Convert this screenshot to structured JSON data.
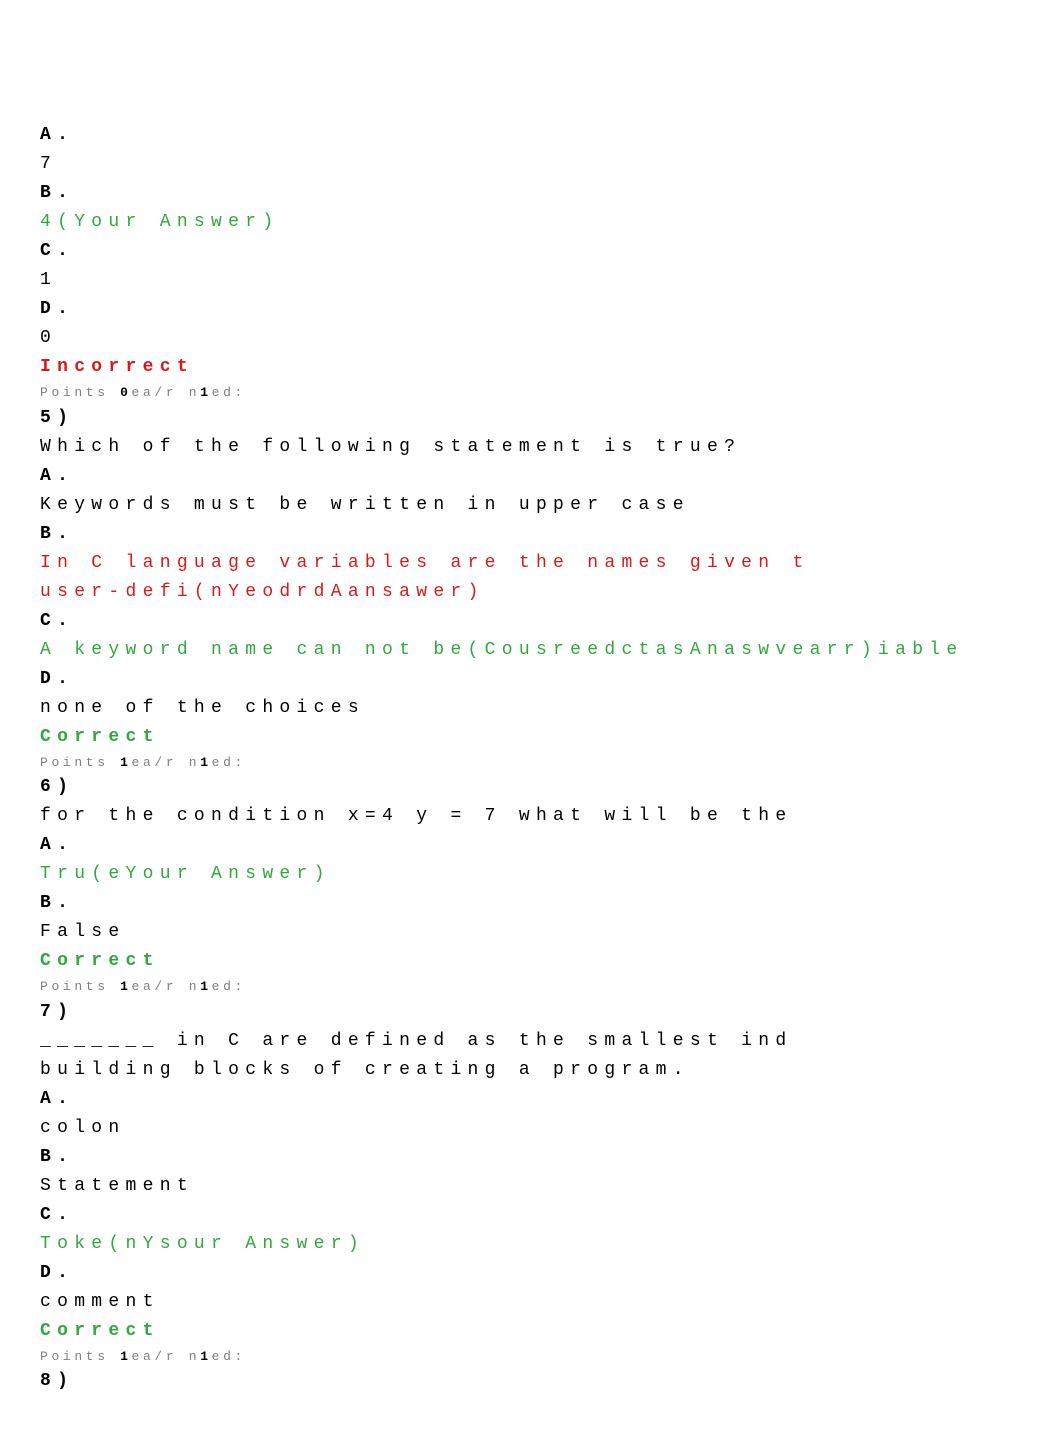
{
  "q4": {
    "opt_a_label": "A.",
    "opt_a_text": "7",
    "opt_b_label": "B.",
    "opt_b_text": "4(Your Answer)",
    "opt_c_label": "C.",
    "opt_c_text": "1",
    "opt_d_label": "D.",
    "opt_d_text": "0",
    "result_label": "Incorrect",
    "points_prefix": "Points ",
    "points_score": "0",
    "points_mid": "ea/r n",
    "points_score2": "1",
    "points_suffix": "ed:"
  },
  "q5": {
    "num_label": "5)",
    "prompt": "Which of the following statement is true?",
    "opt_a_label": "A.",
    "opt_a_text": "Keywords must be written in upper case",
    "opt_b_label": "B.",
    "opt_b_text_line1": "In C language variables are the names given t",
    "opt_b_text_line2": "user-defi(nYeodrdAansawer)",
    "opt_c_label": "C.",
    "opt_c_text": "A keyword name can not be(CousreedctasAnaswvearr)iable",
    "opt_d_label": "D.",
    "opt_d_text": "none of the choices",
    "result_label": "Correct",
    "points_prefix": "Points ",
    "points_score": "1",
    "points_mid": "ea/r n",
    "points_score2": "1",
    "points_suffix": "ed:"
  },
  "q6": {
    "num_label": "6)",
    "prompt": "for the condition x=4 y = 7 what will be the",
    "opt_a_label": "A.",
    "opt_a_text": "Tru(eYour Answer)",
    "opt_b_label": "B.",
    "opt_b_text": "False",
    "result_label": "Correct",
    "points_prefix": "Points ",
    "points_score": "1",
    "points_mid": "ea/r n",
    "points_score2": "1",
    "points_suffix": "ed:"
  },
  "q7": {
    "num_label": "7)",
    "prompt_line1": "_______ in C are defined as the smallest ind",
    "prompt_line2": "building blocks of creating a program.",
    "opt_a_label": "A.",
    "opt_a_text": "colon",
    "opt_b_label": "B.",
    "opt_b_text": "Statement",
    "opt_c_label": "C.",
    "opt_c_text": "Toke(nYsour Answer)",
    "opt_d_label": "D.",
    "opt_d_text": "comment",
    "result_label": "Correct",
    "points_prefix": "Points ",
    "points_score": "1",
    "points_mid": "ea/r n",
    "points_score2": "1",
    "points_suffix": "ed:"
  },
  "q8": {
    "num_label": "8)"
  }
}
